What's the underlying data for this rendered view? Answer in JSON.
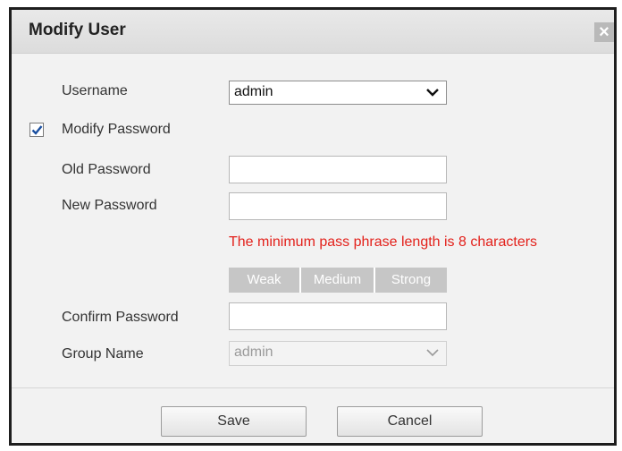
{
  "dialog": {
    "title": "Modify User",
    "close_symbol": "×"
  },
  "form": {
    "username_label": "Username",
    "username_value": "admin",
    "modify_password_label": "Modify Password",
    "modify_password_checked": true,
    "old_password_label": "Old Password",
    "old_password_value": "",
    "new_password_label": "New Password",
    "new_password_value": "",
    "hint": "The minimum pass phrase length is 8 characters",
    "strength_levels": [
      "Weak",
      "Medium",
      "Strong"
    ],
    "confirm_password_label": "Confirm Password",
    "confirm_password_value": "",
    "group_name_label": "Group Name",
    "group_name_value": "admin"
  },
  "buttons": {
    "save": "Save",
    "cancel": "Cancel"
  },
  "colors": {
    "hint_text": "#e3211b",
    "strength_bar": "#c6c6c6",
    "check_mark": "#1a4fa0"
  },
  "icons": {
    "close": "close-icon",
    "dropdown": "chevron-down-icon",
    "check": "checkmark-icon"
  }
}
